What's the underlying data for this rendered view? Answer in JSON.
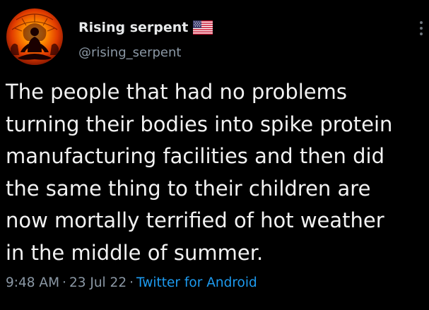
{
  "tweet": {
    "author": {
      "display_name": "Rising serpent",
      "handle": "@rising_serpent",
      "avatar": "meditating-figure-fire-mandala",
      "badge_icon": "us-flag-icon"
    },
    "text_lines": [
      "The people that had no problems",
      "turning their bodies into spike protein",
      "manufacturing facilities and then did",
      "the same thing to their children are",
      "now mortally terrified of hot weather",
      "in the middle of summer."
    ],
    "time": "9:48 AM",
    "date": "23 Jul 22",
    "source": "Twitter for Android",
    "separator": "·"
  },
  "colors": {
    "background": "#000000",
    "primary_text": "#e7e9ea",
    "secondary_text": "#8b98a5",
    "link": "#1d9bf0"
  }
}
